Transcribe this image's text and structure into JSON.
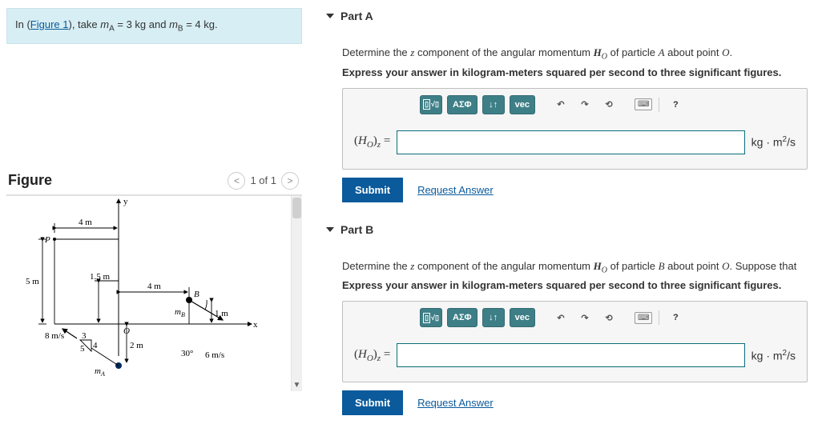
{
  "problem_statement": {
    "prefix": "In (",
    "figure_link": "Figure 1",
    "mid": "), take ",
    "mA_sym": "m",
    "mA_sub": "A",
    "mA_val": " = 3 kg and ",
    "mB_sym": "m",
    "mB_sub": "B",
    "mB_val": " = 4 kg."
  },
  "figure": {
    "title": "Figure",
    "pager_text": "1 of 1",
    "labels": {
      "y": "y",
      "x": "x",
      "P": "P",
      "O": "O",
      "B": "B",
      "dim4m_top": "4 m",
      "dim5m": "5 m",
      "dim1_5m": "1.5 m",
      "dim4m_right": "4 m",
      "dim1m": "1 m",
      "dim2m": "2 m",
      "v8": "8 m/s",
      "ang34": "3",
      "ang34b": "4",
      "ang34c": "5",
      "mB": "m",
      "mB_sub": "B",
      "ang30": "30°",
      "v6": "6 m/s",
      "mA": "m",
      "mA_sub": "A"
    }
  },
  "parts": [
    {
      "title": "Part A",
      "desc_pre": "Determine the ",
      "desc_var": "z",
      "desc_mid": " component of the angular momentum ",
      "desc_H": "H",
      "desc_Hsub": "O",
      "desc_mid2": " of particle ",
      "desc_particle": "A",
      "desc_mid3": " about point ",
      "desc_point": "O",
      "desc_end": ".",
      "instruction": "Express your answer in kilogram-meters squared per second to three significant figures.",
      "lhs_pre": "(",
      "lhs_H": "H",
      "lhs_Hsub": "O",
      "lhs_close": ")",
      "lhs_comp": "z",
      "lhs_eq": " =",
      "units_pre": "kg · m",
      "units_sup": "2",
      "units_post": "/s",
      "submit": "Submit",
      "request": "Request Answer"
    },
    {
      "title": "Part B",
      "desc_pre": "Determine the ",
      "desc_var": "z",
      "desc_mid": " component of the angular momentum ",
      "desc_H": "H",
      "desc_Hsub": "O",
      "desc_mid2": " of particle ",
      "desc_particle": "B",
      "desc_mid3": " about point ",
      "desc_point": "O",
      "desc_end": ". Suppose that",
      "instruction": "Express your answer in kilogram-meters squared per second to three significant figures.",
      "lhs_pre": "(",
      "lhs_H": "H",
      "lhs_Hsub": "O",
      "lhs_close": ")",
      "lhs_comp": "z",
      "lhs_eq": " =",
      "units_pre": "kg · m",
      "units_sup": "2",
      "units_post": "/s",
      "submit": "Submit",
      "request": "Request Answer"
    }
  ],
  "toolbar": {
    "templates": "▢√▢",
    "greek": "ΑΣΦ",
    "updown": "↓↑",
    "vec": "vec",
    "undo": "↶",
    "redo": "↷",
    "reset": "⟲",
    "keyboard": "⌨",
    "help": "?"
  }
}
